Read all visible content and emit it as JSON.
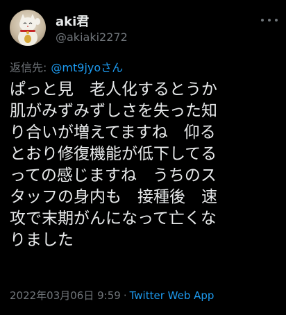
{
  "author": {
    "display_name": "aki君",
    "handle": "@akiaki2272",
    "avatar_icon": "maneki-neko-avatar-icon"
  },
  "reply": {
    "label": "返信先:",
    "mention": "@mt9jyoさん"
  },
  "tweet": {
    "lines": [
      "ぱっと見　老人化するとうか",
      "肌がみずみずしさを失った知",
      "り合いが増えてますね　仰る",
      "とおり修復機能が低下してる",
      "っての感じますね　うちのス",
      "タッフの身内も　接種後　速",
      "攻で末期がんになって亡くな",
      "りました"
    ]
  },
  "meta": {
    "timestamp": "2022年03月06日 9:59",
    "separator": "·",
    "source_app": "Twitter Web App"
  },
  "colors": {
    "background": "#000000",
    "text": "#e7e9ea",
    "muted": "#71767b",
    "link": "#1d9bf0"
  },
  "icons": {
    "more": "more-horizontal-icon"
  }
}
